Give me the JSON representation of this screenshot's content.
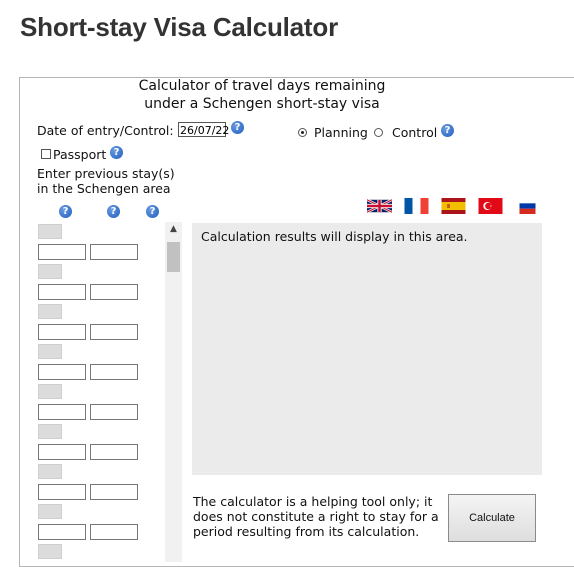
{
  "page": {
    "title": "Short-stay Visa Calculator"
  },
  "calculator": {
    "heading_line1": "Calculator of travel days remaining",
    "heading_line2": "under a Schengen short-stay visa",
    "entry_label": "Date of entry/Control:",
    "entry_value": "26/07/22",
    "mode_options": [
      {
        "label": "Planning",
        "selected": true
      },
      {
        "label": "Control",
        "selected": false
      }
    ],
    "passport_label": "Passport",
    "passport_checked": false,
    "stays_label_line1": "Enter previous stay(s)",
    "stays_label_line2": "in the Schengen area",
    "languages": [
      "english-flag",
      "french-flag",
      "spanish-flag",
      "turkish-flag",
      "russian-flag"
    ],
    "results_placeholder": "Calculation results will display in this area.",
    "disclaimer": "The calculator is a helping tool only; it does not constitute a right to stay for a period resulting from its calculation.",
    "calculate_label": "Calculate"
  },
  "colors": {
    "help_icon": "#1f5cbf",
    "title": "#333333",
    "results_bg": "#ebebeb"
  }
}
